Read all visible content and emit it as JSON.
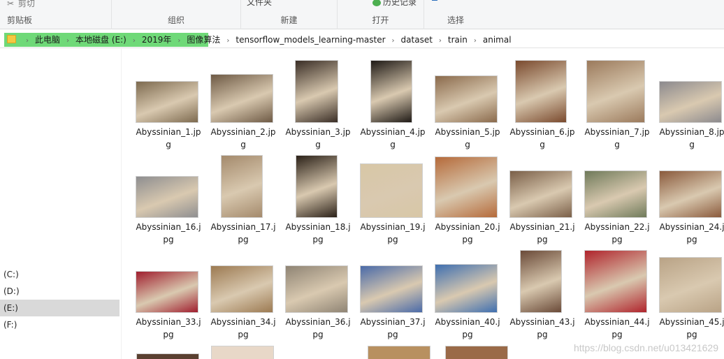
{
  "ribbon": {
    "clipboard": {
      "cut_label": "剪切",
      "group_label": "剪贴板"
    },
    "organize": {
      "group_label": "组织"
    },
    "new": {
      "partial_label": "文件夹",
      "group_label": "新建"
    },
    "open": {
      "history_label": "历史记录",
      "group_label": "打开"
    },
    "select": {
      "group_label": "选择"
    }
  },
  "breadcrumb": [
    "此电脑",
    "本地磁盘 (E:)",
    "2019年",
    "图像算法",
    "tensorflow_models_learning-master",
    "dataset",
    "train",
    "animal"
  ],
  "drives": [
    {
      "label": "(C:)",
      "selected": false
    },
    {
      "label": "(D:)",
      "selected": false
    },
    {
      "label": "(E:)",
      "selected": true
    },
    {
      "label": "(F:)",
      "selected": false
    }
  ],
  "files": [
    {
      "line1": "Abyssinian_1.jp",
      "line2": "g"
    },
    {
      "line1": "Abyssinian_2.jp",
      "line2": "g"
    },
    {
      "line1": "Abyssinian_3.jp",
      "line2": "g"
    },
    {
      "line1": "Abyssinian_4.jp",
      "line2": "g"
    },
    {
      "line1": "Abyssinian_5.jp",
      "line2": "g"
    },
    {
      "line1": "Abyssinian_6.jp",
      "line2": "g"
    },
    {
      "line1": "Abyssinian_7.jp",
      "line2": "g"
    },
    {
      "line1": "Abyssinian_8.jp",
      "line2": "g"
    },
    {
      "line1": "Abyssinian_16.j",
      "line2": "pg"
    },
    {
      "line1": "Abyssinian_17.j",
      "line2": "pg"
    },
    {
      "line1": "Abyssinian_18.j",
      "line2": "pg"
    },
    {
      "line1": "Abyssinian_19.j",
      "line2": "pg"
    },
    {
      "line1": "Abyssinian_20.j",
      "line2": "pg"
    },
    {
      "line1": "Abyssinian_21.j",
      "line2": "pg"
    },
    {
      "line1": "Abyssinian_22.j",
      "line2": "pg"
    },
    {
      "line1": "Abyssinian_24.j",
      "line2": "pg"
    },
    {
      "line1": "Abyssinian_33.j",
      "line2": "pg"
    },
    {
      "line1": "Abyssinian_34.j",
      "line2": "pg"
    },
    {
      "line1": "Abyssinian_36.j",
      "line2": "pg"
    },
    {
      "line1": "Abyssinian_37.j",
      "line2": "pg"
    },
    {
      "line1": "Abyssinian_40.j",
      "line2": "pg"
    },
    {
      "line1": "Abyssinian_43.j",
      "line2": "pg"
    },
    {
      "line1": "Abyssinian_44.j",
      "line2": "pg"
    },
    {
      "line1": "Abyssinian_45.j",
      "line2": "pg"
    }
  ],
  "thumb_colors": [
    "#7d6a4f",
    "#6e5a45",
    "#3a2e26",
    "#1f1a16",
    "#8a6a4c",
    "#7a4a2e",
    "#9b7a5c",
    "#8c8a8e",
    "#8e8e90",
    "#a48a6c",
    "#2b2118",
    "#d8c7a6",
    "#b56a3a",
    "#7a5f48",
    "#6f7a5a",
    "#8a5a3c",
    "#a01e2e",
    "#9c7a52",
    "#8f8474",
    "#4a6aa8",
    "#3f6fb0",
    "#6a4a38",
    "#b0242c",
    "#b9a386"
  ],
  "watermark": "https://blog.csdn.net/u013421629"
}
